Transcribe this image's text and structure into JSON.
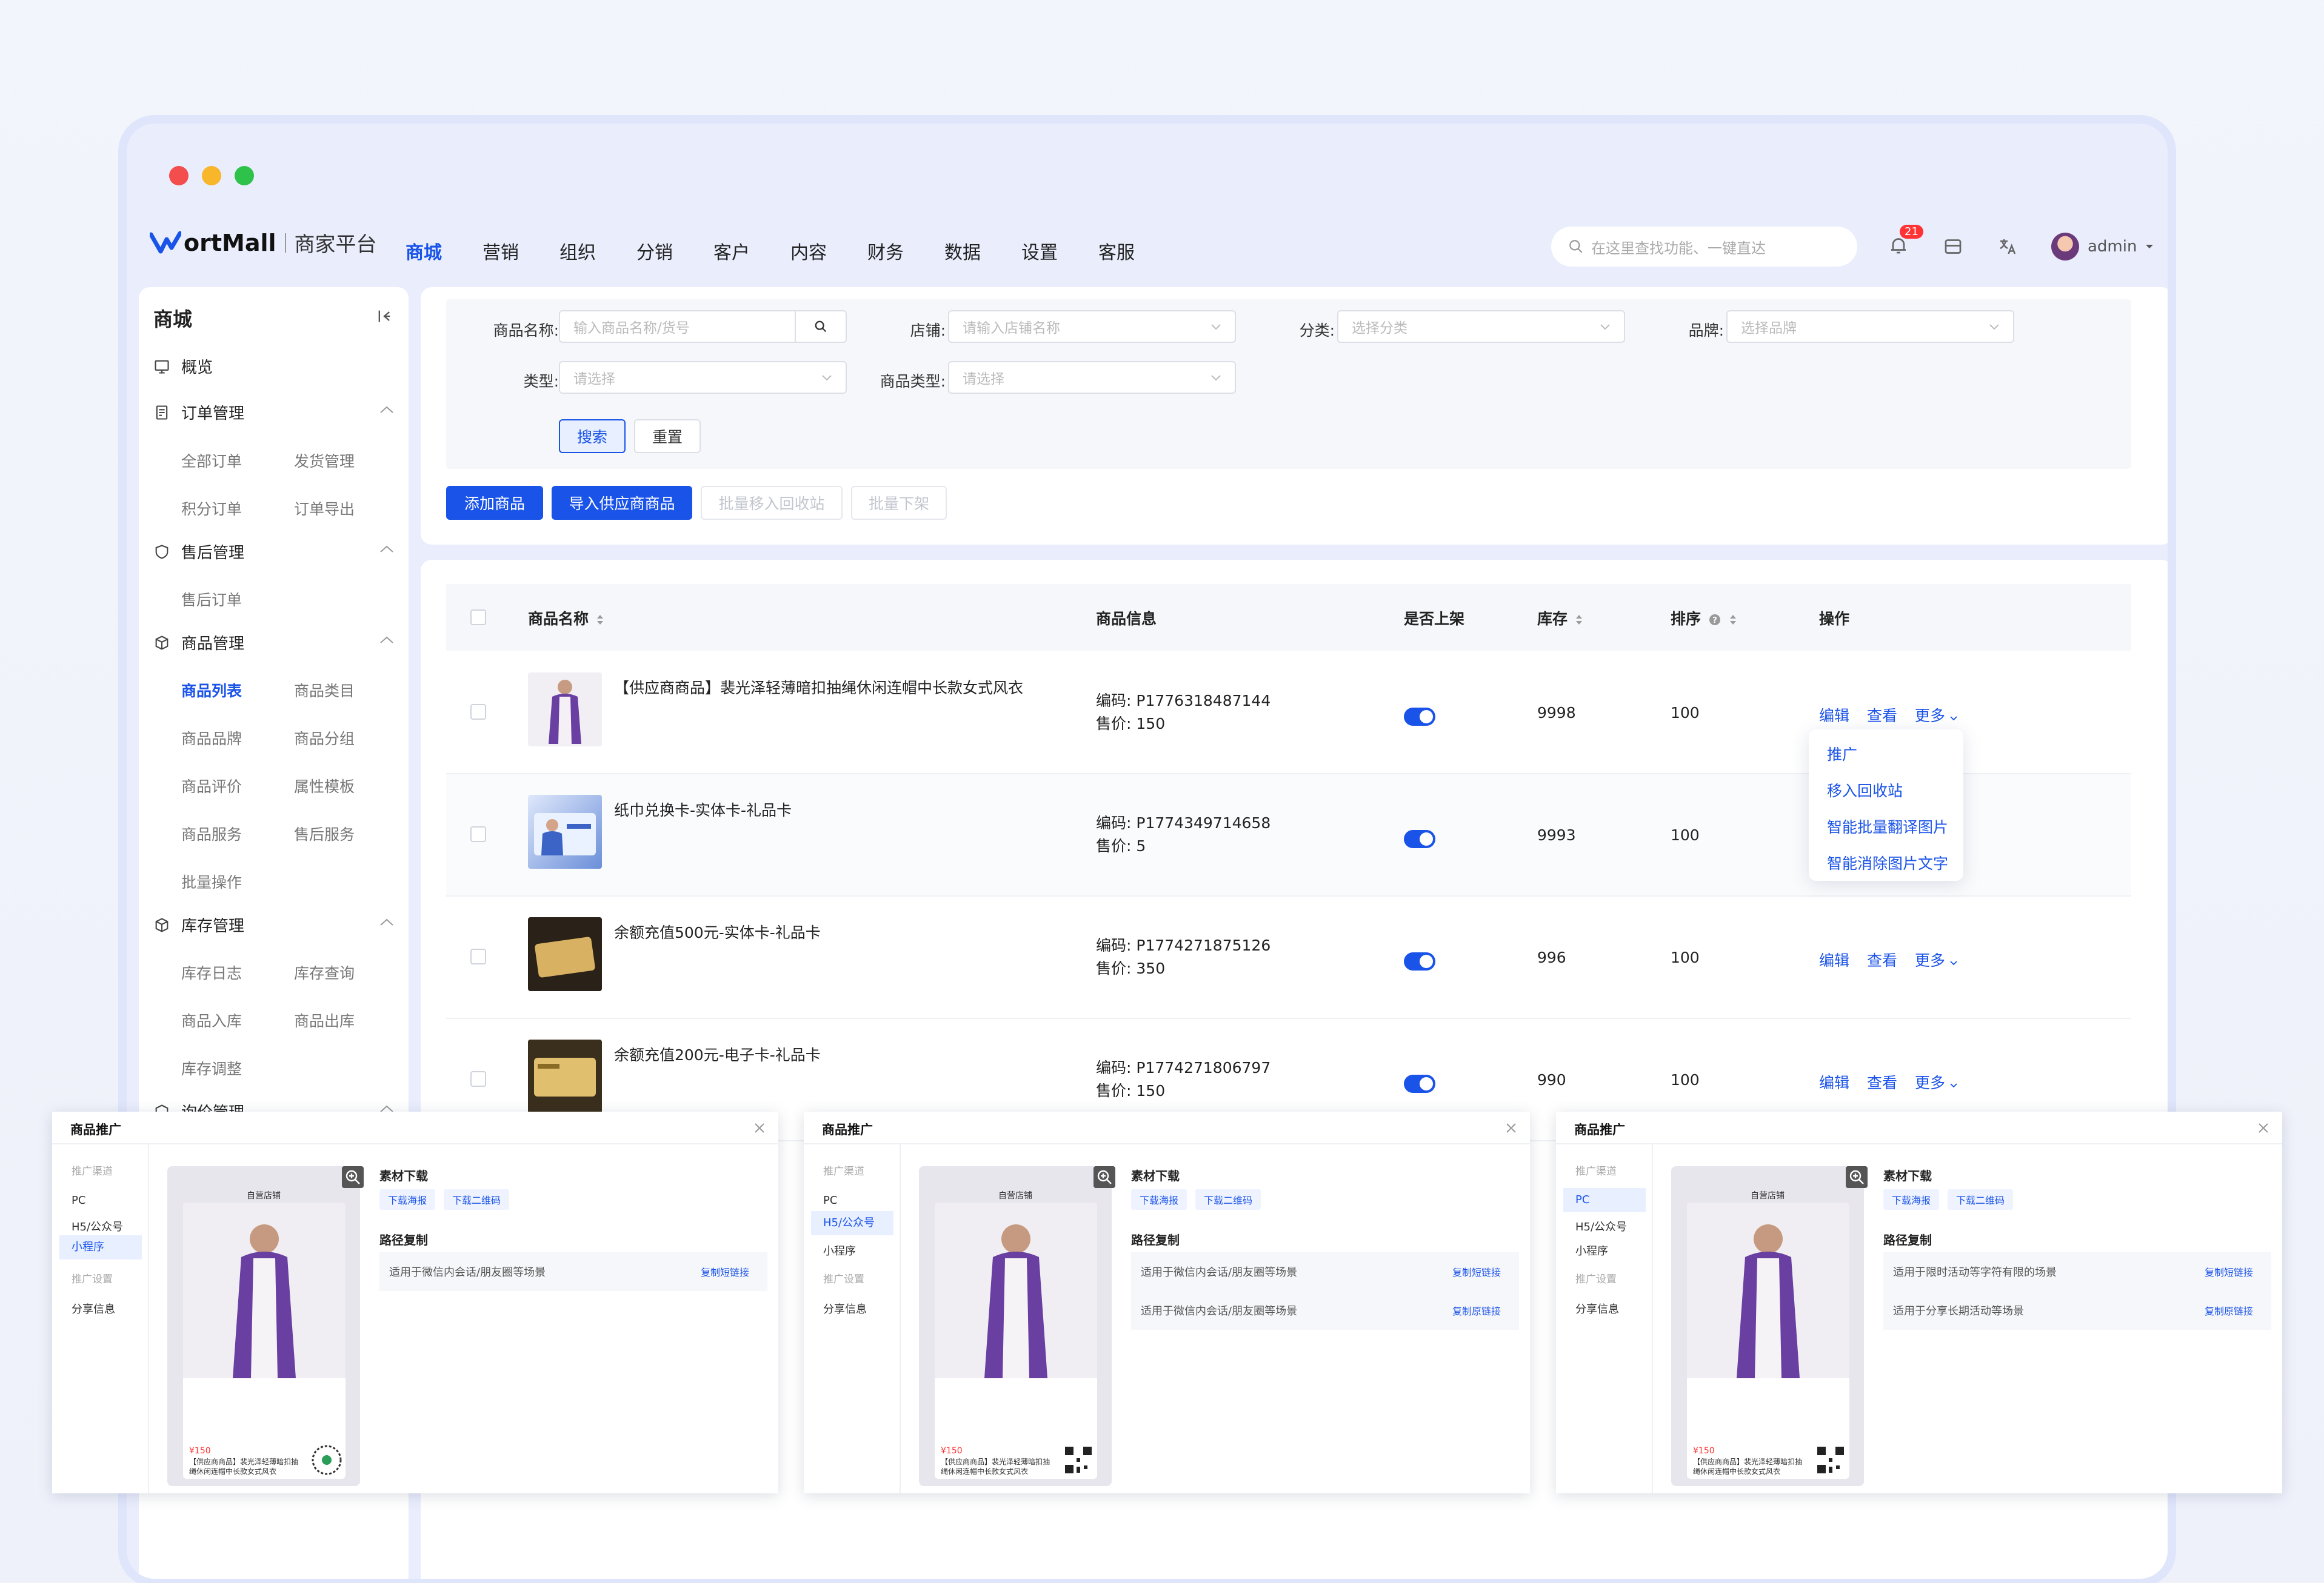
{
  "app": {
    "logo_text": "ortMall",
    "logo_subtitle": "商家平台",
    "nav": [
      "商城",
      "营销",
      "组织",
      "分销",
      "客户",
      "内容",
      "财务",
      "数据",
      "设置",
      "客服"
    ],
    "search_placeholder": "在这里查找功能、一键直达",
    "notification_count": "21",
    "user": "admin"
  },
  "sidebar": {
    "title": "商城",
    "overview": "概览",
    "groups": [
      {
        "label": "订单管理",
        "items": [
          "全部订单",
          "发货管理",
          "积分订单",
          "订单导出"
        ]
      },
      {
        "label": "售后管理",
        "items": [
          "售后订单"
        ]
      },
      {
        "label": "商品管理",
        "items": [
          "商品列表",
          "商品类目",
          "商品品牌",
          "商品分组",
          "商品评价",
          "属性模板",
          "商品服务",
          "售后服务",
          "批量操作"
        ]
      },
      {
        "label": "库存管理",
        "items": [
          "库存日志",
          "库存查询",
          "商品入库",
          "商品出库",
          "库存调整"
        ]
      },
      {
        "label": "询价管理",
        "items": []
      }
    ],
    "active_item": "商品列表"
  },
  "filters": {
    "name_label": "商品名称:",
    "name_placeholder": "输入商品名称/货号",
    "shop_label": "店铺:",
    "shop_placeholder": "请输入店铺名称",
    "category_label": "分类:",
    "category_placeholder": "选择分类",
    "brand_label": "品牌:",
    "brand_placeholder": "选择品牌",
    "type_label": "类型:",
    "type_placeholder": "请选择",
    "goods_type_label": "商品类型:",
    "goods_type_placeholder": "请选择",
    "search_btn": "搜索",
    "reset_btn": "重置"
  },
  "actions": {
    "add": "添加商品",
    "import": "导入供应商商品",
    "batch_recycle": "批量移入回收站",
    "batch_off": "批量下架"
  },
  "table": {
    "headers": {
      "name": "商品名称",
      "info": "商品信息",
      "on_shelf": "是否上架",
      "stock": "库存",
      "sort": "排序",
      "ops": "操作"
    },
    "code_prefix": "编码:",
    "price_prefix": "售价:",
    "rows": [
      {
        "name": "【供应商商品】裴光泽轻薄暗扣抽绳休闲连帽中长款女式风衣",
        "code": "P1776318487144",
        "price": "150",
        "stock": "9998",
        "sort": "100"
      },
      {
        "name": "纸巾兑换卡-实体卡-礼品卡",
        "code": "P1774349714658",
        "price": "5",
        "stock": "9993",
        "sort": "100"
      },
      {
        "name": "余额充值500元-实体卡-礼品卡",
        "code": "P1774271875126",
        "price": "350",
        "stock": "996",
        "sort": "100"
      },
      {
        "name": "余额充值200元-电子卡-礼品卡",
        "code": "P1774271806797",
        "price": "150",
        "stock": "990",
        "sort": "100"
      }
    ],
    "ops": {
      "edit": "编辑",
      "view": "查看",
      "more": "更多"
    },
    "dropdown": [
      "推广",
      "移入回收站",
      "智能批量翻译图片",
      "智能消除图片文字"
    ]
  },
  "modals": [
    {
      "title": "商品推广",
      "side": {
        "channel": "推广渠道",
        "pc": "PC",
        "h5": "H5/公众号",
        "mini": "小程序",
        "settings": "推广设置",
        "share": "分享信息"
      },
      "selected": "mini",
      "store": "自营店铺",
      "price": "¥150",
      "desc": "【供应商商品】裴光泽轻薄暗扣抽绳休闲连帽中长款女式风衣",
      "download_title": "素材下载",
      "download_poster": "下载海报",
      "download_qr": "下载二维码",
      "path_title": "路径复制",
      "paths": [
        {
          "text": "适用于微信内会话/朋友圈等场景",
          "link": "复制短链接"
        }
      ]
    },
    {
      "title": "商品推广",
      "side": {
        "channel": "推广渠道",
        "pc": "PC",
        "h5": "H5/公众号",
        "mini": "小程序",
        "settings": "推广设置",
        "share": "分享信息"
      },
      "selected": "h5",
      "store": "自营店铺",
      "price": "¥150",
      "desc": "【供应商商品】裴光泽轻薄暗扣抽绳休闲连帽中长款女式风衣",
      "download_title": "素材下载",
      "download_poster": "下载海报",
      "download_qr": "下载二维码",
      "path_title": "路径复制",
      "paths": [
        {
          "text": "适用于微信内会话/朋友圈等场景",
          "link": "复制短链接"
        },
        {
          "text": "适用于微信内会话/朋友圈等场景",
          "link": "复制原链接"
        }
      ]
    },
    {
      "title": "商品推广",
      "side": {
        "channel": "推广渠道",
        "pc": "PC",
        "h5": "H5/公众号",
        "mini": "小程序",
        "settings": "推广设置",
        "share": "分享信息"
      },
      "selected": "pc",
      "store": "自营店铺",
      "price": "¥150",
      "desc": "【供应商商品】裴光泽轻薄暗扣抽绳休闲连帽中长款女式风衣",
      "download_title": "素材下载",
      "download_poster": "下载海报",
      "download_qr": "下载二维码",
      "path_title": "路径复制",
      "paths": [
        {
          "text": "适用于限时活动等字符有限的场景",
          "link": "复制短链接"
        },
        {
          "text": "适用于分享长期活动等场景",
          "link": "复制原链接"
        }
      ]
    }
  ],
  "colors": {
    "accent": "#1a53e8",
    "danger": "#ff3333"
  }
}
